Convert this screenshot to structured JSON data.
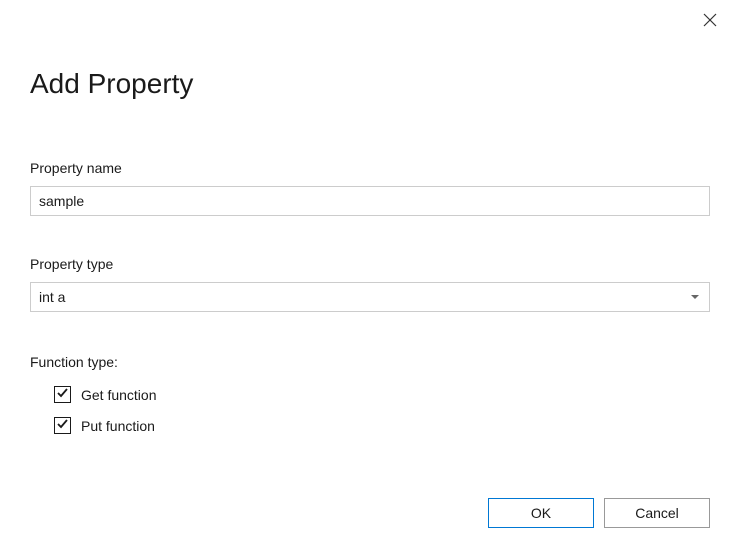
{
  "title": "Add Property",
  "property_name": {
    "label": "Property name",
    "value": "sample"
  },
  "property_type": {
    "label": "Property type",
    "value": "int a"
  },
  "function_type": {
    "label": "Function type:",
    "get": {
      "label": "Get function",
      "checked": true
    },
    "put": {
      "label": "Put function",
      "checked": true
    }
  },
  "buttons": {
    "ok": "OK",
    "cancel": "Cancel"
  }
}
